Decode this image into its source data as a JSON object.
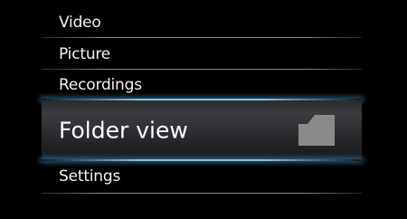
{
  "menu": {
    "items": [
      {
        "label": "Video"
      },
      {
        "label": "Picture"
      },
      {
        "label": "Recordings"
      },
      {
        "label": "Folder view",
        "selected": true,
        "icon": "folder-icon"
      },
      {
        "label": "Settings"
      }
    ]
  },
  "colors": {
    "background": "#000000",
    "highlight_glow": "#8ccdf5",
    "folder_icon": "#8a8a8a"
  }
}
